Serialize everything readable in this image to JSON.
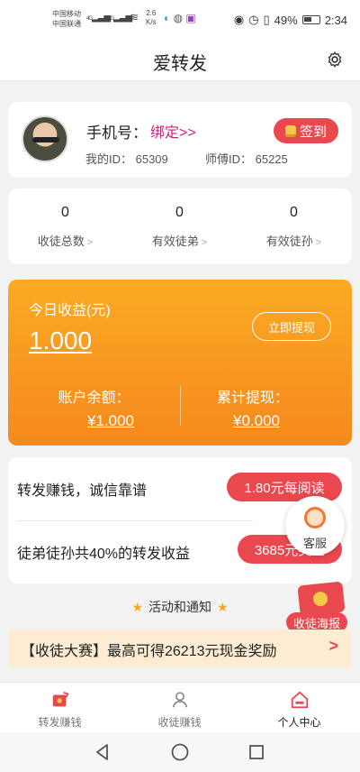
{
  "status_bar": {
    "carrier1": "中国移动",
    "carrier2": "中国联通",
    "sig1": "4G",
    "sig2": "3G",
    "speed": "2.6",
    "speed_unit": "K/s",
    "battery": "49%",
    "time": "2:34"
  },
  "header": {
    "title": "爱转发"
  },
  "profile": {
    "phone_label": "手机号：",
    "bind_link": "绑定>>",
    "my_id": "我的ID： 65309",
    "master_id": "师傅ID： 65225",
    "checkin_label": "签到"
  },
  "stats": [
    {
      "value": "0",
      "label": "收徒总数"
    },
    {
      "value": "0",
      "label": "有效徒弟"
    },
    {
      "value": "0",
      "label": "有效徒孙"
    }
  ],
  "earnings": {
    "today_label": "今日收益(元)",
    "today_value": "1.000",
    "withdraw_label": "立即提现",
    "balance_label": "账户余额：",
    "balance_value": "¥1.000",
    "total_label": "累计提现：",
    "total_value": "¥0.000"
  },
  "promo": {
    "row1_text": "转发赚钱，诚信靠谱",
    "row1_badge": "1.80元每阅读",
    "row2_text": "徒弟徒孙共40%的转发收益",
    "row2_badge": "3685元奖金"
  },
  "customer_service": {
    "label": "客服"
  },
  "poster": {
    "label": "收徒海报"
  },
  "notice": {
    "title": "活动和通知"
  },
  "contest": {
    "text": "【收徒大赛】最高可得26213元现金奖励"
  },
  "tabs": [
    {
      "label": "转发赚钱"
    },
    {
      "label": "收徒赚钱"
    },
    {
      "label": "个人中心"
    }
  ],
  "colors": {
    "accent_red": "#e8484e",
    "orange_start": "#fbaa24",
    "orange_end": "#f5891c",
    "link_pink": "#d1207a"
  }
}
